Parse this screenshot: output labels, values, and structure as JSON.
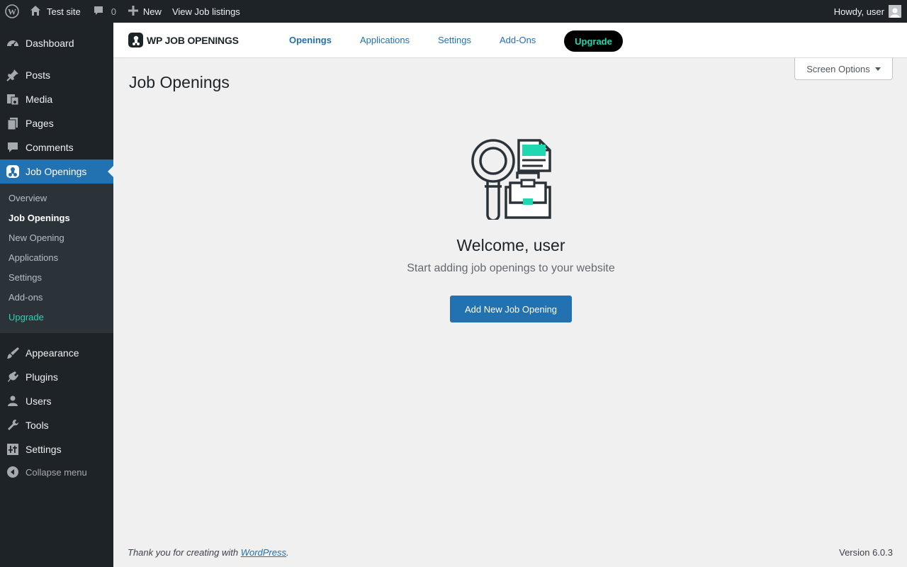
{
  "adminbar": {
    "site_name": "Test site",
    "comments_count": "0",
    "new_label": "New",
    "view_jobs_label": "View Job listings",
    "howdy_label": "Howdy, user"
  },
  "sidebar": {
    "items": [
      {
        "label": "Dashboard",
        "icon": "dashboard-icon"
      },
      {
        "label": "Posts",
        "icon": "pin-icon"
      },
      {
        "label": "Media",
        "icon": "media-icon"
      },
      {
        "label": "Pages",
        "icon": "pages-icon"
      },
      {
        "label": "Comments",
        "icon": "comment-icon"
      },
      {
        "label": "Job Openings",
        "icon": "job-openings-icon"
      },
      {
        "label": "Appearance",
        "icon": "brush-icon"
      },
      {
        "label": "Plugins",
        "icon": "plugin-icon"
      },
      {
        "label": "Users",
        "icon": "user-icon"
      },
      {
        "label": "Tools",
        "icon": "wrench-icon"
      },
      {
        "label": "Settings",
        "icon": "settings-icon"
      }
    ],
    "submenu": [
      "Overview",
      "Job Openings",
      "New Opening",
      "Applications",
      "Settings",
      "Add-ons",
      "Upgrade"
    ],
    "collapse_label": "Collapse menu"
  },
  "plugin_header": {
    "logo_text": "WP JOB OPENINGS",
    "nav": [
      "Openings",
      "Applications",
      "Settings",
      "Add-Ons"
    ],
    "upgrade_label": "Upgrade"
  },
  "screen_options_label": "Screen Options",
  "page_title": "Job Openings",
  "welcome": {
    "title": "Welcome, user",
    "subtitle": "Start adding job openings to your website",
    "button_label": "Add New Job Opening"
  },
  "footer": {
    "thanks_prefix": "Thank you for creating with ",
    "thanks_link": "WordPress",
    "thanks_suffix": ".",
    "version": "Version 6.0.3"
  },
  "colors": {
    "admin_dark": "#1d2327",
    "accent_blue": "#2271b1",
    "upgrade_teal": "#1fd8b2"
  }
}
